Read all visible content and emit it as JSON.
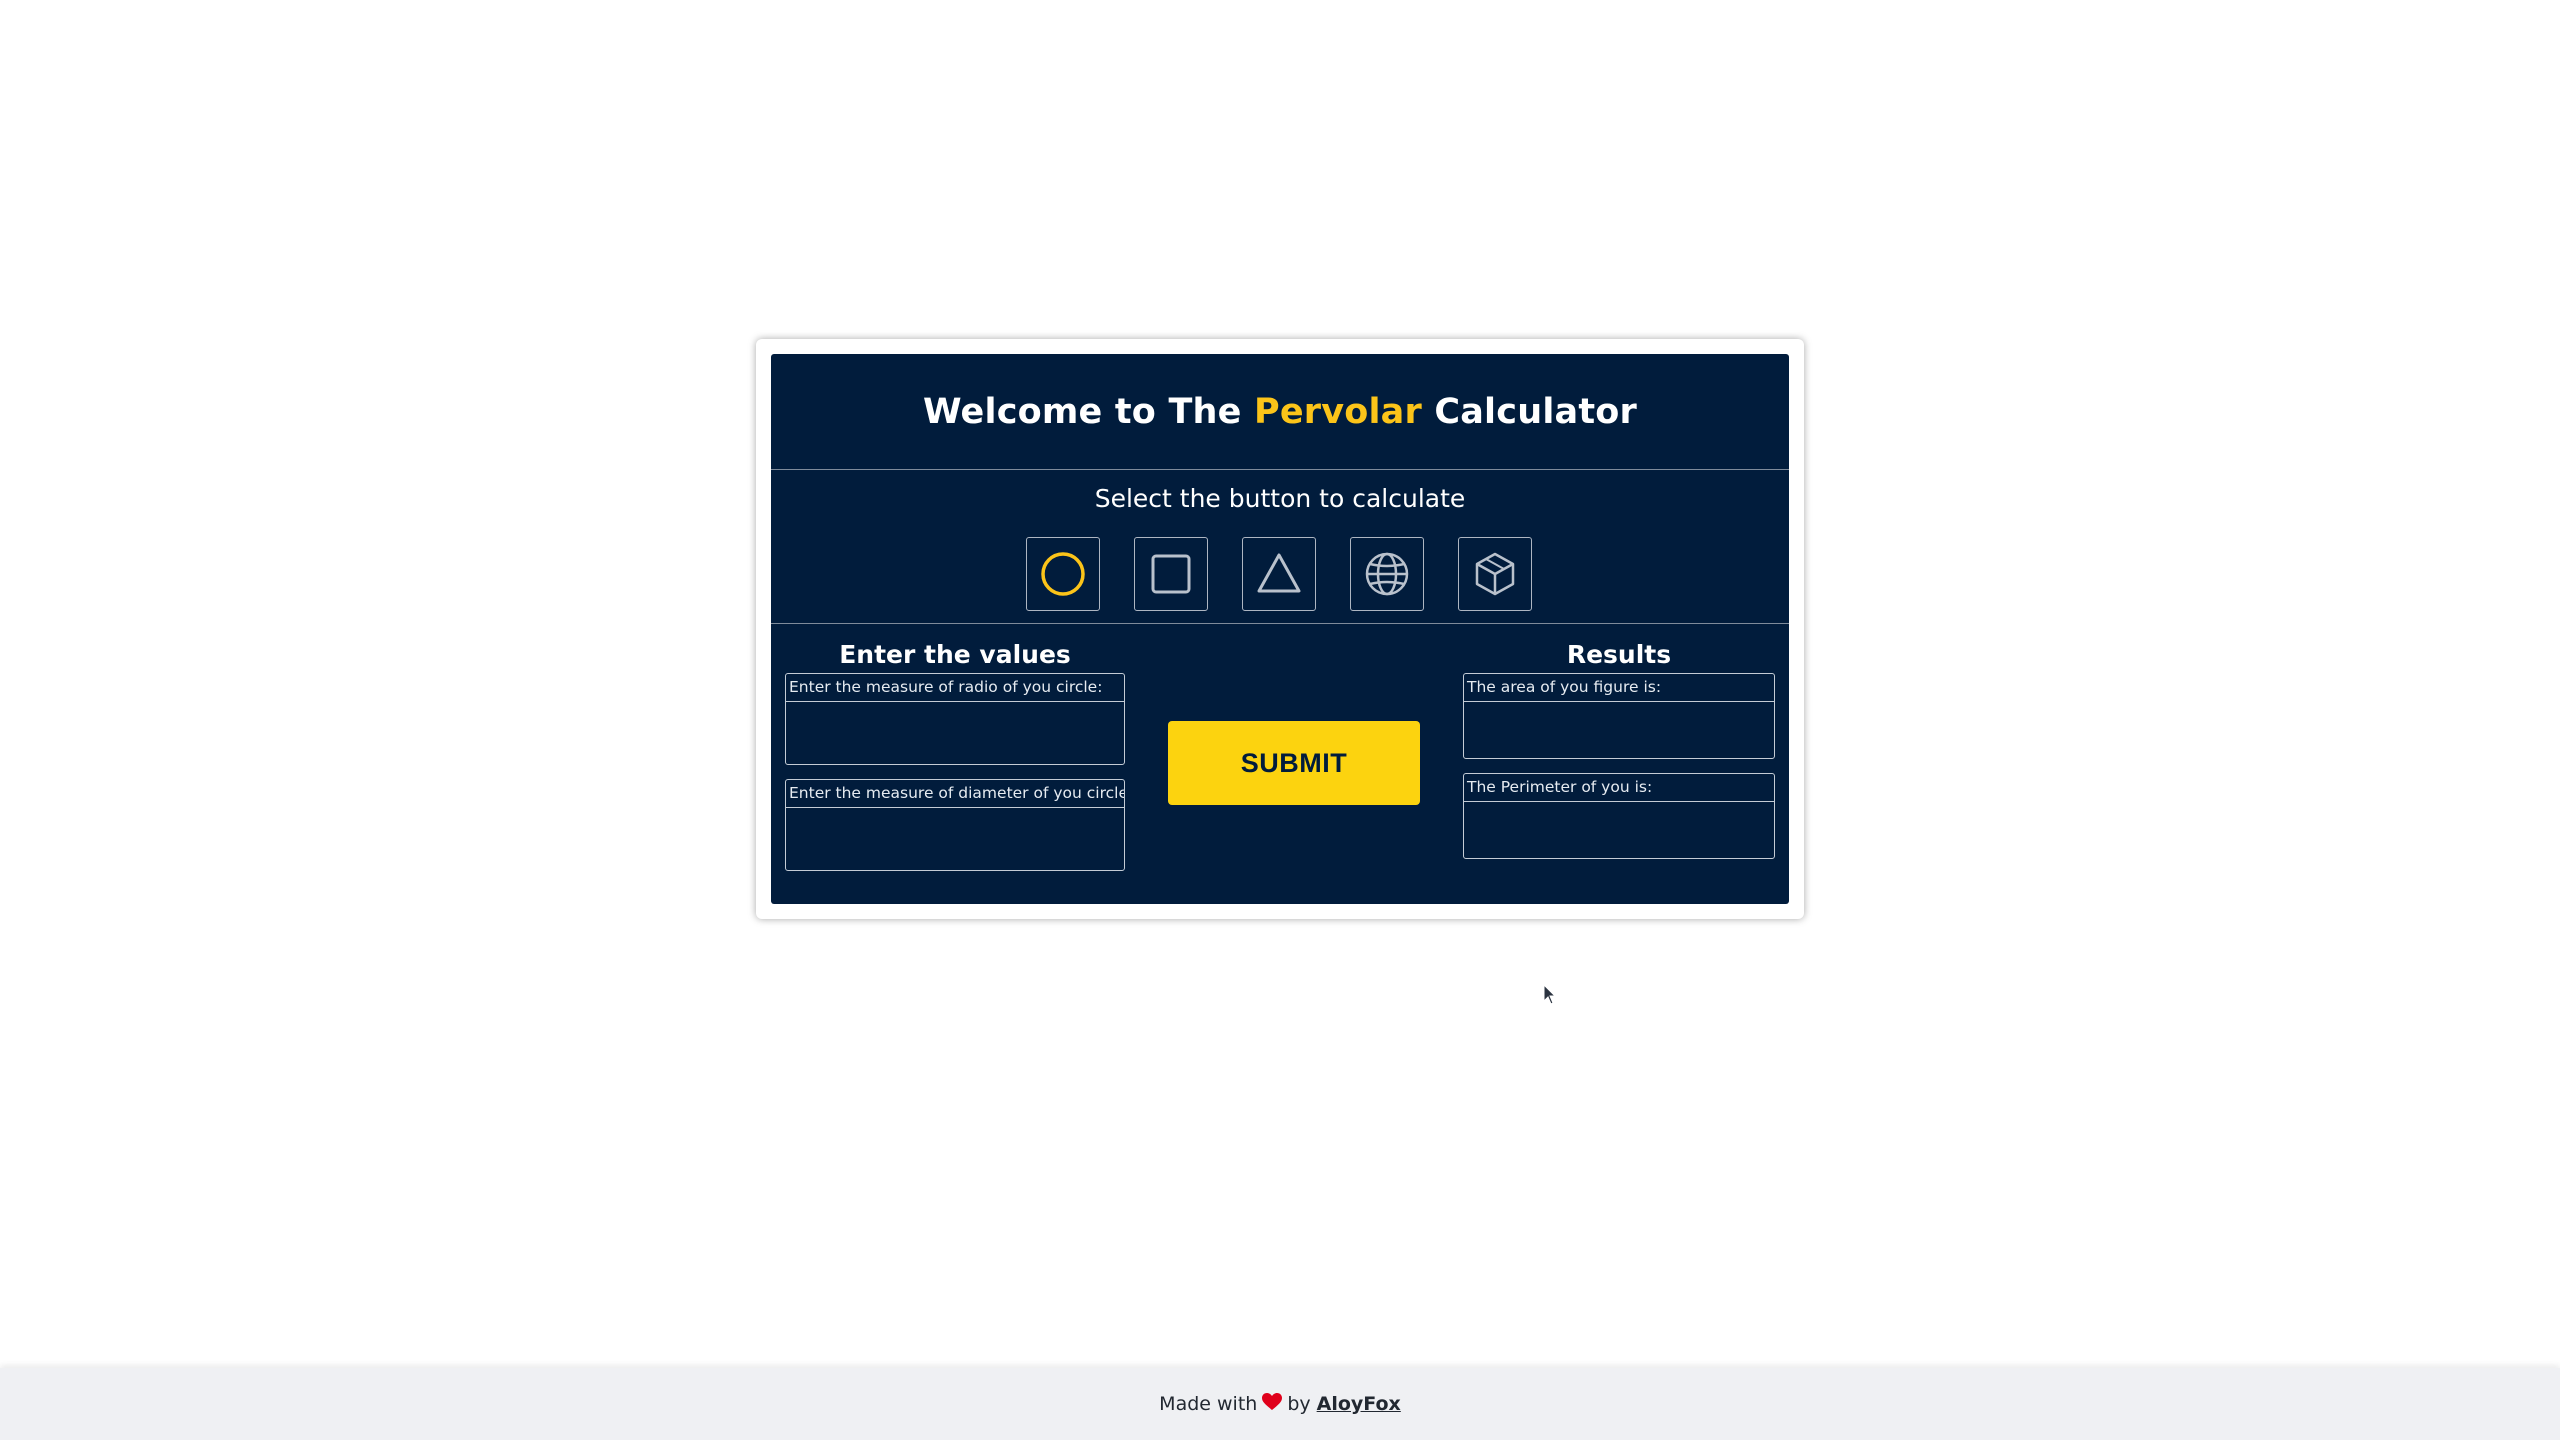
{
  "header": {
    "title_before": "Welcome to The ",
    "title_accent": "Pervolar",
    "title_after": " Calculator",
    "accent_color": "#fcc419"
  },
  "shape_selector": {
    "label": "Select the button to calculate",
    "buttons": [
      {
        "icon": "circle-icon",
        "selected": true
      },
      {
        "icon": "square-icon",
        "selected": false
      },
      {
        "icon": "triangle-icon",
        "selected": false
      },
      {
        "icon": "sphere-icon",
        "selected": false
      },
      {
        "icon": "cube-icon",
        "selected": false
      }
    ]
  },
  "inputs": {
    "heading": "Enter the values",
    "radius_label": "Enter the measure of radio of you circle:",
    "radius_value": "",
    "diameter_label": "Enter the measure of diameter of you circle:",
    "diameter_value": ""
  },
  "submit": {
    "label": "SUBMIT",
    "color": "#fcd30f"
  },
  "results": {
    "heading": "Results",
    "area_label": "The area of you figure is:",
    "area_value": "",
    "perimeter_label": "The Perimeter of you is:",
    "perimeter_value": ""
  },
  "footer": {
    "made_with": "Made with",
    "by": "by",
    "author": "AloyFox",
    "heart_color": "#e0001b"
  },
  "theme": {
    "card_background": "#011c3c"
  }
}
